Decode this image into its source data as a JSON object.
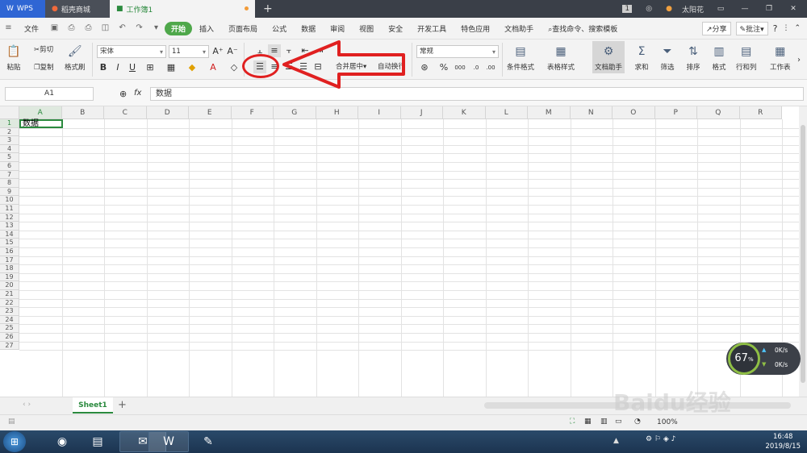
{
  "titlebar": {
    "app": "WPS",
    "tab_store": "稻壳商城",
    "tab_doc": "工作簿1",
    "plus": "+",
    "badge": "1",
    "user": "太阳花"
  },
  "menu": {
    "file": "文件",
    "items": [
      "开始",
      "插入",
      "页面布局",
      "公式",
      "数据",
      "审阅",
      "视图",
      "安全",
      "开发工具",
      "特色应用",
      "文档助手"
    ],
    "search": "查找命令、搜索模板",
    "share": "分享",
    "comment": "批注"
  },
  "ribbon": {
    "paste": "粘贴",
    "cut": "剪切",
    "copy": "复制",
    "format_painter": "格式刷",
    "font_name": "宋体",
    "font_size": "11",
    "bold": "B",
    "italic": "I",
    "underline": "U",
    "merge_center": "合并居中",
    "wrap": "自动换行",
    "number_format": "常规",
    "percent": "%",
    "cond_format": "条件格式",
    "table_style": "表格样式",
    "doc_helper": "文档助手",
    "sum": "求和",
    "filter": "筛选",
    "sort": "排序",
    "format": "格式",
    "row_col": "行和列",
    "worksheet": "工作表"
  },
  "formula": {
    "cell_ref": "A1",
    "fx": "fx",
    "content": "数据"
  },
  "grid": {
    "columns": [
      "A",
      "B",
      "C",
      "D",
      "E",
      "F",
      "G",
      "H",
      "I",
      "J",
      "K",
      "L",
      "M",
      "N",
      "O",
      "P",
      "Q",
      "R"
    ],
    "rows": [
      "1",
      "2",
      "3",
      "4",
      "5",
      "6",
      "7",
      "8",
      "9",
      "10",
      "11",
      "12",
      "13",
      "14",
      "15",
      "16",
      "17",
      "18",
      "19",
      "20",
      "21",
      "22",
      "23",
      "24",
      "25",
      "26",
      "27"
    ],
    "a1_value": "数据"
  },
  "sheets": {
    "active": "Sheet1",
    "add": "+"
  },
  "status": {
    "zoom": "100%"
  },
  "speed": {
    "percent": "67",
    "up": "0K/s",
    "down": "0K/s"
  },
  "taskbar": {
    "time": "16:48",
    "date": "2019/8/15"
  },
  "watermark": "Baidu经验"
}
